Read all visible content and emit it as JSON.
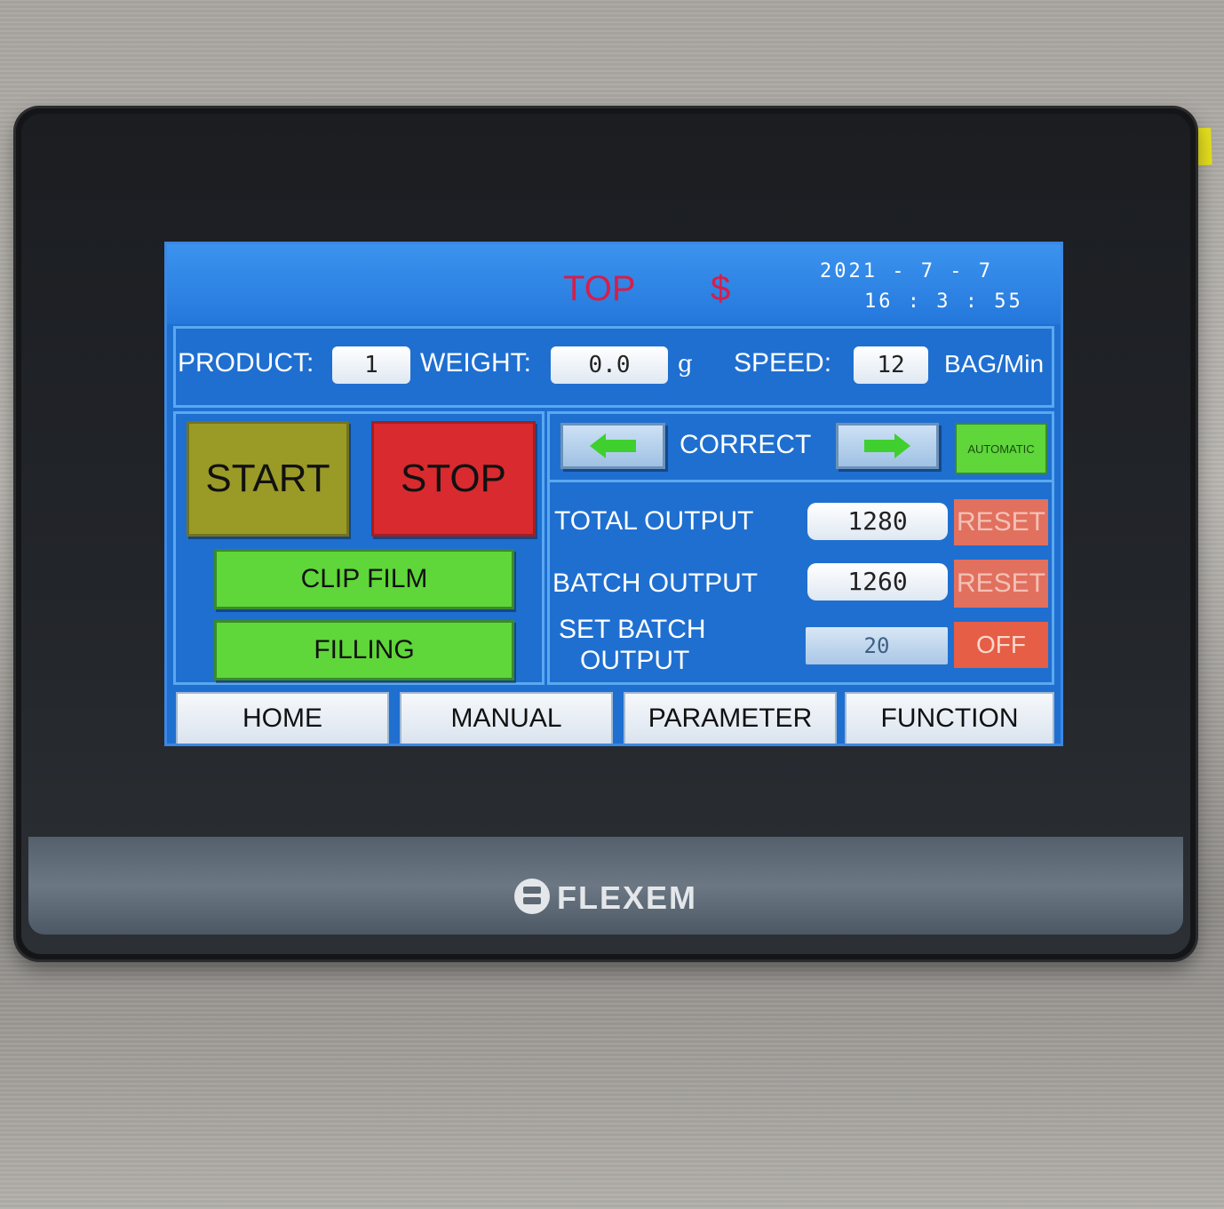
{
  "header": {
    "title": "TOP",
    "title_symbol": "$",
    "date": "2021 - 7 - 7",
    "time": "16 : 3 : 55"
  },
  "info": {
    "product_label": "PRODUCT:",
    "product_value": "1",
    "weight_label": "WEIGHT:",
    "weight_value": "0.0",
    "weight_unit": "g",
    "speed_label": "SPEED:",
    "speed_value": "12",
    "speed_unit": "BAG/Min"
  },
  "controls": {
    "start_label": "START",
    "stop_label": "STOP",
    "clip_film_label": "CLIP FILM",
    "filling_label": "FILLING",
    "correct_label": "CORRECT",
    "automatic_label": "AUTOMATIC",
    "colors": {
      "start": "#9a9a27",
      "stop": "#d92a2f",
      "green": "#5fd63a",
      "reset": "#e2705e",
      "off": "#e55e45",
      "arrow": "#3fcf2e"
    }
  },
  "counters": {
    "total_output_label": "TOTAL OUTPUT",
    "total_output_value": "1280",
    "batch_output_label": "BATCH OUTPUT",
    "batch_output_value": "1260",
    "set_batch_label_line1": "SET BATCH",
    "set_batch_label_line2": "OUTPUT",
    "set_batch_value": "20",
    "reset_label": "RESET",
    "off_label": "OFF"
  },
  "nav": [
    "HOME",
    "MANUAL",
    "PARAMETER",
    "FUNCTION"
  ],
  "device": {
    "brand": "FLEXEM"
  }
}
